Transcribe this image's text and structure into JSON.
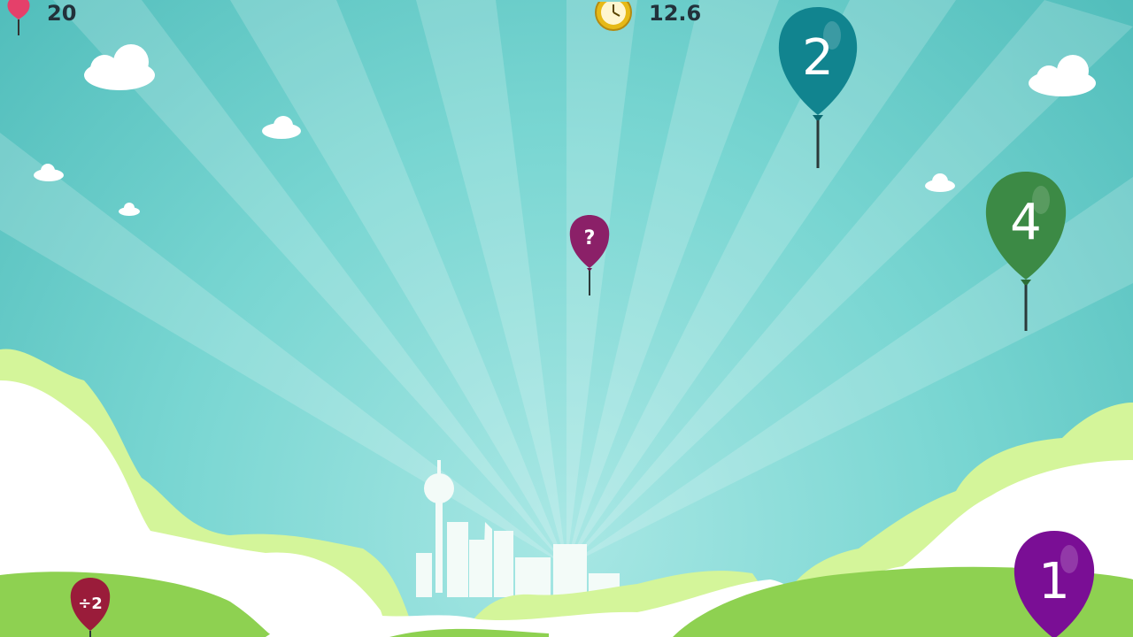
{
  "hud": {
    "balloon_count": "20",
    "balloon_icon": "balloon-icon",
    "timer": "12.6",
    "timer_icon": "stopwatch-icon"
  },
  "colors": {
    "sky": "#66cdc8",
    "sky_light": "#a6e6e3",
    "cloud": "#ffffff",
    "hill_light": "#d4f59a",
    "hill_green": "#8ed151",
    "hud_balloon": "#e5406a"
  },
  "balloons": [
    {
      "label": "2",
      "color": "#11848f",
      "kind": "number"
    },
    {
      "label": "4",
      "color": "#3c8a45",
      "kind": "number"
    },
    {
      "label": "?",
      "color": "#8b2068",
      "kind": "mystery"
    },
    {
      "label": "1",
      "color": "#7a0e95",
      "kind": "number"
    },
    {
      "label": "÷2",
      "color": "#9a1c3a",
      "kind": "operator"
    }
  ]
}
